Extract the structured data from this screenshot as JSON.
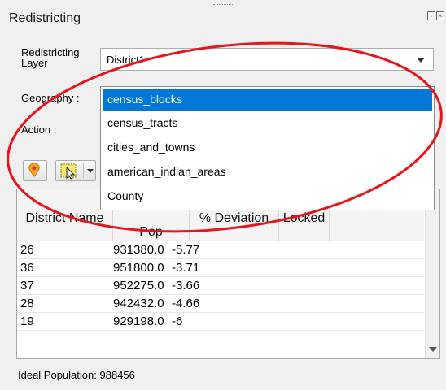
{
  "panel": {
    "title": "Redistricting"
  },
  "layer": {
    "label": "Redistricting Layer",
    "value": "District1"
  },
  "geography": {
    "label": "Geography :"
  },
  "action": {
    "label": "Action :"
  },
  "dropdown": {
    "options": [
      "census_blocks",
      "census_tracts",
      "cities_and_towns",
      "american_indian_areas",
      "County"
    ],
    "selected": "census_blocks"
  },
  "table": {
    "headers": [
      {
        "line1": "District Name",
        "line2": ""
      },
      {
        "line1": "",
        "line2": "Pop"
      },
      {
        "line1": "% Deviation",
        "line2": ""
      },
      {
        "line1": "Locked",
        "line2": ""
      }
    ],
    "rows": [
      {
        "name": "26",
        "pop": "931380.0",
        "dev": "-5.77"
      },
      {
        "name": "36",
        "pop": "951800.0",
        "dev": "-3.71"
      },
      {
        "name": "37",
        "pop": "952275.0",
        "dev": "-3.66"
      },
      {
        "name": "28",
        "pop": "942432.0",
        "dev": "-4.66"
      },
      {
        "name": "19",
        "pop": "929198.0",
        "dev": "-6"
      }
    ]
  },
  "footer": {
    "ideal_label": "Ideal Population:",
    "ideal_value": "988456"
  },
  "colors": {
    "selection": "#0078d7",
    "annotation": "#e8141b"
  },
  "icons": {
    "float": "float-icon",
    "close": "close-icon",
    "pin": "map-pin-icon",
    "select": "select-features-icon"
  }
}
